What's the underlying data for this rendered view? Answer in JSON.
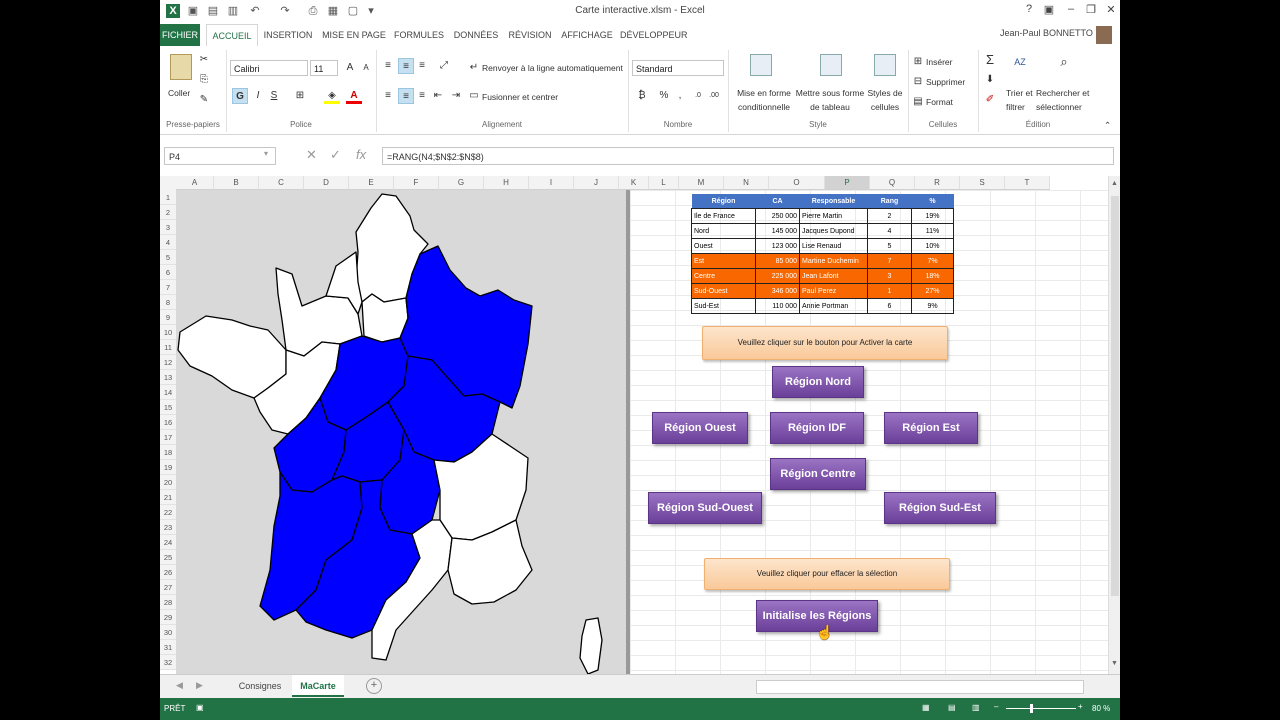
{
  "window": {
    "title": "Carte interactive.xlsm - Excel",
    "user": "Jean-Paul BONNETTO"
  },
  "tabs": [
    "FICHIER",
    "ACCUEIL",
    "INSERTION",
    "MISE EN PAGE",
    "FORMULES",
    "DONNÉES",
    "RÉVISION",
    "AFFICHAGE",
    "DÉVELOPPEUR"
  ],
  "ribbon": {
    "paste": "Coller",
    "font_name": "Calibri",
    "font_size": "11",
    "wrap_text": "Renvoyer à la ligne automatiquement",
    "merge": "Fusionner et centrer",
    "number_format": "Standard",
    "cond_format": [
      "Mise en forme",
      "conditionnelle"
    ],
    "table_format": [
      "Mettre sous forme",
      "de tableau"
    ],
    "cell_styles": [
      "Styles de",
      "cellules"
    ],
    "insert": "Insérer",
    "delete": "Supprimer",
    "format": "Format",
    "sort": [
      "Trier et",
      "filtrer"
    ],
    "find": [
      "Rechercher et",
      "sélectionner"
    ],
    "groups": [
      "Presse-papiers",
      "Police",
      "Alignement",
      "Nombre",
      "Style",
      "Cellules",
      "Édition"
    ],
    "bold": "G",
    "italic": "I",
    "underline": "S"
  },
  "formula_bar": {
    "cell": "P4",
    "formula": "=RANG(N4;$N$2:$N$8)"
  },
  "columns": [
    "A",
    "B",
    "C",
    "D",
    "E",
    "F",
    "G",
    "H",
    "I",
    "J",
    "K",
    "L",
    "M",
    "N",
    "O",
    "P",
    "Q",
    "R",
    "S",
    "T"
  ],
  "selected_column": "P",
  "rows": [
    "1",
    "2",
    "3",
    "4",
    "5",
    "6",
    "7",
    "8",
    "9",
    "10",
    "11",
    "12",
    "13",
    "14",
    "15",
    "16",
    "17",
    "18",
    "19",
    "20",
    "21",
    "22",
    "23",
    "24",
    "25",
    "26",
    "27",
    "28",
    "29",
    "30",
    "31",
    "32"
  ],
  "table": {
    "headers": [
      "Région",
      "CA",
      "Responsable",
      "Rang",
      "%"
    ],
    "rows": [
      {
        "region": "Ile de France",
        "ca": "250 000",
        "resp": "Pierre Martin",
        "rang": "2",
        "pct": "19%",
        "hl": false
      },
      {
        "region": "Nord",
        "ca": "145 000",
        "resp": "Jacques Dupond",
        "rang": "4",
        "pct": "11%",
        "hl": false
      },
      {
        "region": "Ouest",
        "ca": "123 000",
        "resp": "Lise Renaud",
        "rang": "5",
        "pct": "10%",
        "hl": false
      },
      {
        "region": "Est",
        "ca": "85 000",
        "resp": "Martine Duchemin",
        "rang": "7",
        "pct": "7%",
        "hl": true
      },
      {
        "region": "Centre",
        "ca": "225 000",
        "resp": "Jean Lafont",
        "rang": "3",
        "pct": "18%",
        "hl": true
      },
      {
        "region": "Sud-Ouest",
        "ca": "346 000",
        "resp": "Paul Perez",
        "rang": "1",
        "pct": "27%",
        "hl": true
      },
      {
        "region": "Sud-Est",
        "ca": "110 000",
        "resp": "Annie Portman",
        "rang": "6",
        "pct": "9%",
        "hl": false
      }
    ]
  },
  "instructions": {
    "activate": "Veuillez cliquer sur le bouton pour Activer la carte",
    "clear": "Veuillez cliquer pour effacer la sélection"
  },
  "buttons": {
    "nord": "Région Nord",
    "ouest": "Région Ouest",
    "idf": "Région IDF",
    "est": "Région Est",
    "centre": "Région Centre",
    "sud_ouest": "Région Sud-Ouest",
    "sud_est": "Région Sud-Est",
    "reset": "Initialise les Régions"
  },
  "map": {
    "selected_color": "#0000ff",
    "unselected_color": "#ffffff"
  },
  "sheets": [
    "Consignes",
    "MaCarte"
  ],
  "active_sheet": "MaCarte",
  "status": {
    "mode": "PRÊT",
    "zoom": "80 %"
  },
  "colors": {
    "excel_green": "#217346",
    "table_header": "#4472c4",
    "highlight": "#f96800",
    "button_purple": "#7b52ab"
  }
}
